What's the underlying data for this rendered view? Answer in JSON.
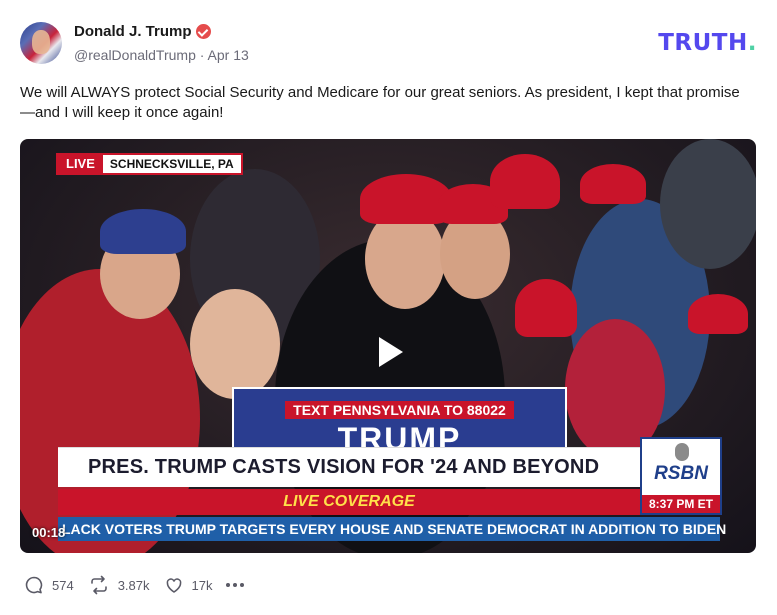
{
  "author": {
    "name": "Donald J. Trump",
    "handle": "@realDonaldTrump",
    "separator": "·",
    "date": "Apr 13"
  },
  "brand": {
    "logo_text": "TRUTH",
    "logo_dot": "."
  },
  "post": {
    "text": "We will ALWAYS protect Social Security and Medicare for our great seniors. As president, I kept that promise—and I will keep it once again!"
  },
  "video": {
    "live_label": "LIVE",
    "location": "SCHNECKSVILLE, PA",
    "podium_text": "TEXT PENNSYLVANIA TO 88022",
    "podium_name": "TRUMP",
    "headline": "PRES. TRUMP CASTS VISION FOR '24 AND BEYOND",
    "coverage": "LIVE COVERAGE",
    "ticker": "LACK VOTERS   TRUMP TARGETS EVERY HOUSE AND SENATE DEMOCRAT IN ADDITION TO BIDEN",
    "network": "RSBN",
    "network_time": "8:37 PM ET",
    "timestamp": "00:18"
  },
  "actions": {
    "replies": "574",
    "retruths": "3.87k",
    "likes": "17k"
  },
  "colors": {
    "brand_purple": "#5448ee",
    "brand_green": "#4fd1a5",
    "verified_red": "#e54b4b",
    "news_red": "#c9142a",
    "news_blue": "#1f5fa8"
  },
  "icons": [
    "verified-badge-icon",
    "play-icon",
    "reply-icon",
    "retruth-icon",
    "like-icon",
    "more-icon"
  ]
}
